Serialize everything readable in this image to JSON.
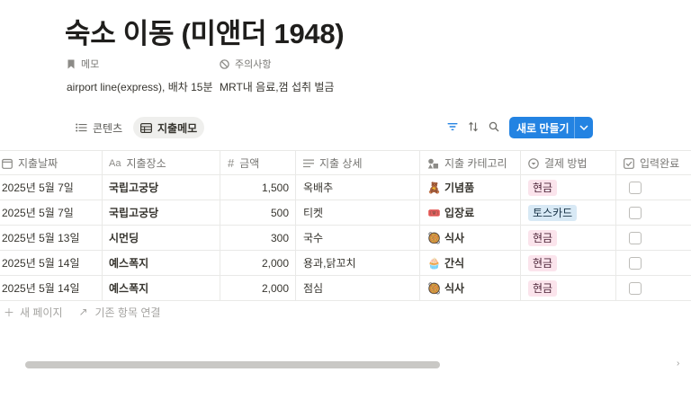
{
  "page": {
    "title": "숙소 이동 (미앤더 1948)"
  },
  "properties": {
    "memo": {
      "label": "메모",
      "icon": "bookmark-icon",
      "value": "airport line(express), 배차 15분"
    },
    "caution": {
      "label": "주의사항",
      "icon": "prohibited-icon",
      "value": "MRT내 음료,껌 섭취 벌금"
    }
  },
  "toolbar": {
    "views": [
      {
        "label": "콘텐츠",
        "icon": "list-icon",
        "active": false
      },
      {
        "label": "지출메모",
        "icon": "table-icon",
        "active": true
      }
    ],
    "tools": [
      "filter-icon",
      "sort-icon",
      "search-icon"
    ],
    "new_button": {
      "label": "새로 만들기",
      "icon": "chevron-down-icon",
      "color": "#2383e2"
    }
  },
  "table": {
    "columns": [
      {
        "label": "지출날짜",
        "icon": "calendar-icon"
      },
      {
        "label": "지출장소",
        "icon": "text-aa-icon",
        "icon_text": "Aa"
      },
      {
        "label": "금액",
        "icon": "number-hash-icon",
        "icon_text": "#"
      },
      {
        "label": "지출 상세",
        "icon": "text-lines-icon"
      },
      {
        "label": "지출 카테고리",
        "icon": "shapes-icon"
      },
      {
        "label": "결제 방법",
        "icon": "select-icon"
      },
      {
        "label": "입력완료",
        "icon": "checkbox-icon"
      }
    ],
    "rows": [
      {
        "date": "2025년 5월 7일",
        "place": "국립고궁당",
        "amount": "1,500",
        "detail": "옥배추",
        "category": "기념품",
        "category_emoji": "🧸",
        "payment": "현금",
        "payment_style": "cash",
        "done": false
      },
      {
        "date": "2025년 5월 7일",
        "place": "국립고궁당",
        "amount": "500",
        "detail": "티켓",
        "category": "입장료",
        "category_emoji": "🎟️",
        "payment": "토스카드",
        "payment_style": "toss",
        "done": false
      },
      {
        "date": "2025년 5월 13일",
        "place": "시먼딩",
        "amount": "300",
        "detail": "국수",
        "category": "식사",
        "category_emoji": "🥘",
        "payment": "현금",
        "payment_style": "cash",
        "done": false
      },
      {
        "date": "2025년 5월 14일",
        "place": "예스폭지",
        "amount": "2,000",
        "detail": "용과,닭꼬치",
        "category": "간식",
        "category_emoji": "🧁",
        "payment": "현금",
        "payment_style": "cash",
        "done": false
      },
      {
        "date": "2025년 5월 14일",
        "place": "예스폭지",
        "amount": "2,000",
        "detail": "점심",
        "category": "식사",
        "category_emoji": "🥘",
        "payment": "현금",
        "payment_style": "cash",
        "done": false
      }
    ],
    "footer": {
      "new_page_label": "새 페이지",
      "link_existing_label": "기존 항목 연결"
    }
  },
  "scrollbar": {
    "thumb_fraction": 0.64
  }
}
